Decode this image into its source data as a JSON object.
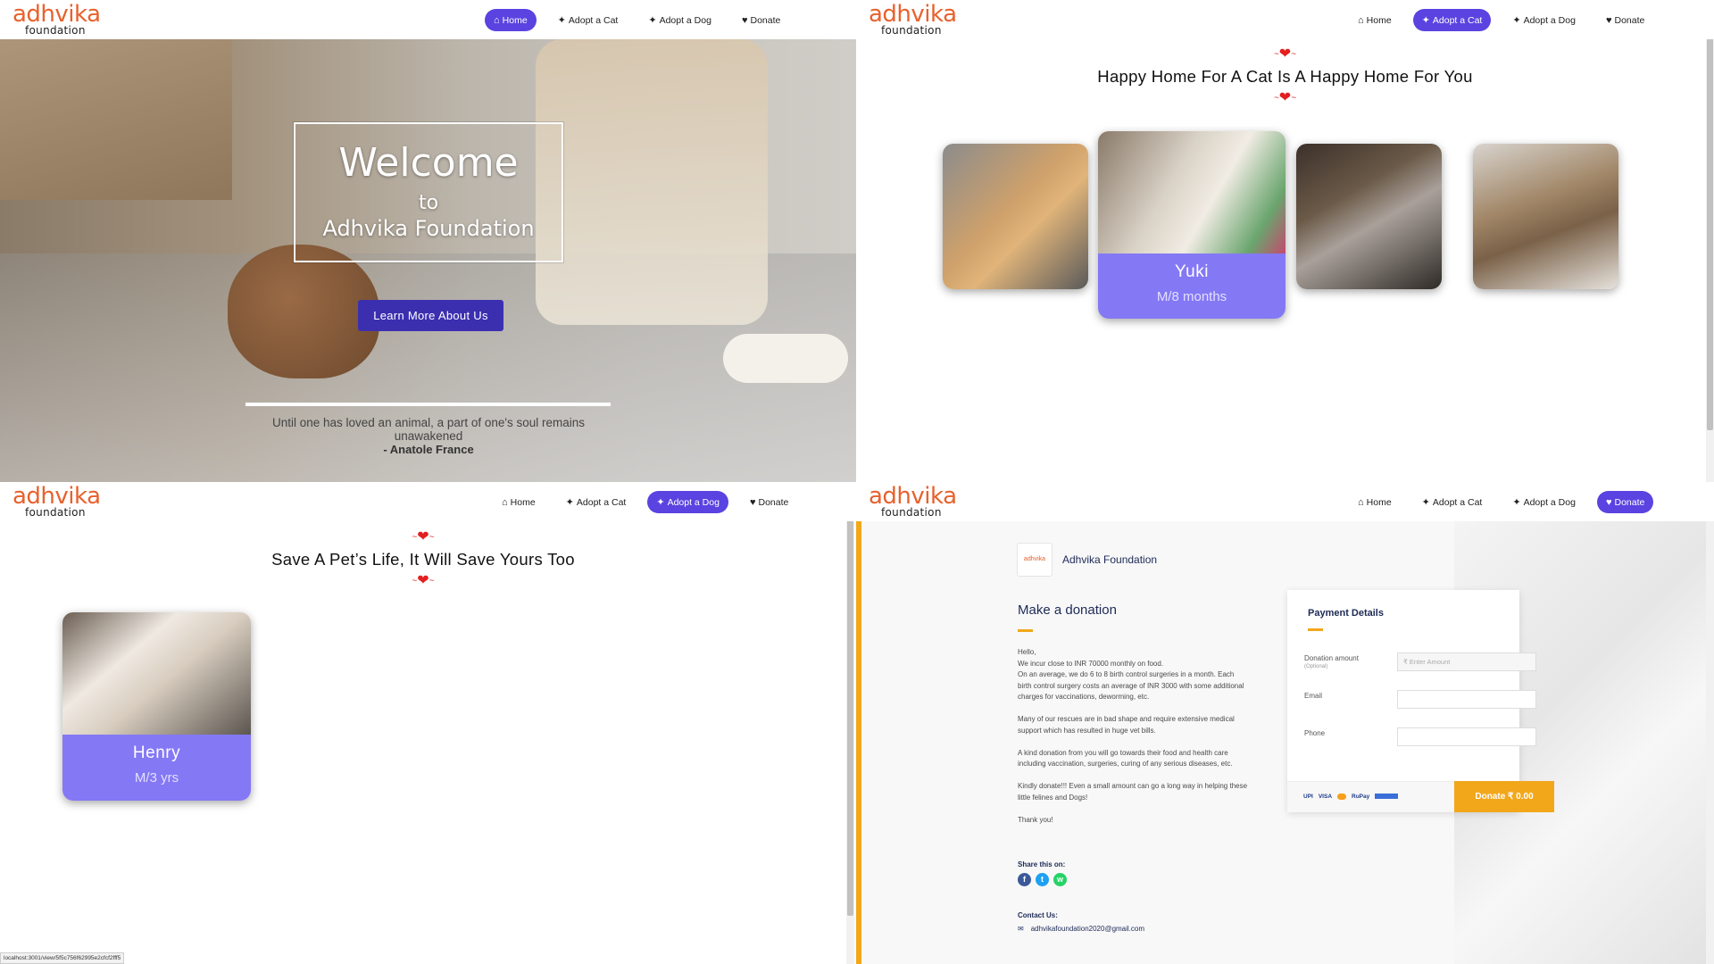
{
  "brand": {
    "name": "adhvika",
    "sub": "foundation"
  },
  "nav": {
    "home": "Home",
    "cat": "Adopt a Cat",
    "dog": "Adopt a Dog",
    "donate": "Donate"
  },
  "hero": {
    "welcome": "Welcome",
    "to": "to",
    "org": "Adhvika Foundation",
    "button": "Learn More About Us",
    "quote": "Until one has loved an animal, a part of one's soul remains unawakened",
    "author": "- Anatole France"
  },
  "cats": {
    "title": "Happy Home For A Cat Is A Happy Home For You",
    "featured": {
      "name": "Yuki",
      "meta": "M/8 months"
    }
  },
  "dogs": {
    "title": "Save A Pet’s Life, It Will Save Yours Too",
    "featured": {
      "name": "Henry",
      "meta": "M/3 yrs"
    }
  },
  "donate": {
    "org_name": "Adhvika Foundation",
    "logo_text": "adhvika",
    "heading": "Make a donation",
    "paragraphs": [
      "Hello,\nWe incur close to INR 70000 monthly on food.\nOn an average, we do 6 to 8 birth control surgeries in a month. Each birth control surgery costs an average of INR 3000 with some additional charges for vaccinations, deworming, etc.",
      "Many of our rescues are in bad shape and require extensive medical support which has resulted in huge vet bills.",
      "A kind donation from you will go towards their food and health care including vaccination, surgeries, curing of any serious diseases, etc.",
      "Kindly donate!!! Even a small amount can go a long way in helping these little felines and Dogs!",
      "Thank you!"
    ],
    "share_label": "Share this on:",
    "contact_label": "Contact Us:",
    "email": "adhvikafoundation2020@gmail.com",
    "payment": {
      "title": "Payment Details",
      "amount_label": "Donation amount",
      "amount_sub": "(Optional)",
      "amount_placeholder": "Enter Amount",
      "currency": "₹",
      "email_label": "Email",
      "phone_label": "Phone",
      "methods": [
        "UPI",
        "VISA",
        "RuPay"
      ],
      "button": "Donate  ₹ 0.00"
    }
  },
  "status_url": "localhost:3001/view/5f5c756f62995e2cfcf2fff5",
  "colors": {
    "accent": "#5a43e0",
    "brand": "#e8612c",
    "card": "#8478f5",
    "heart": "#e41f1f",
    "donate": "#f2a71b"
  }
}
